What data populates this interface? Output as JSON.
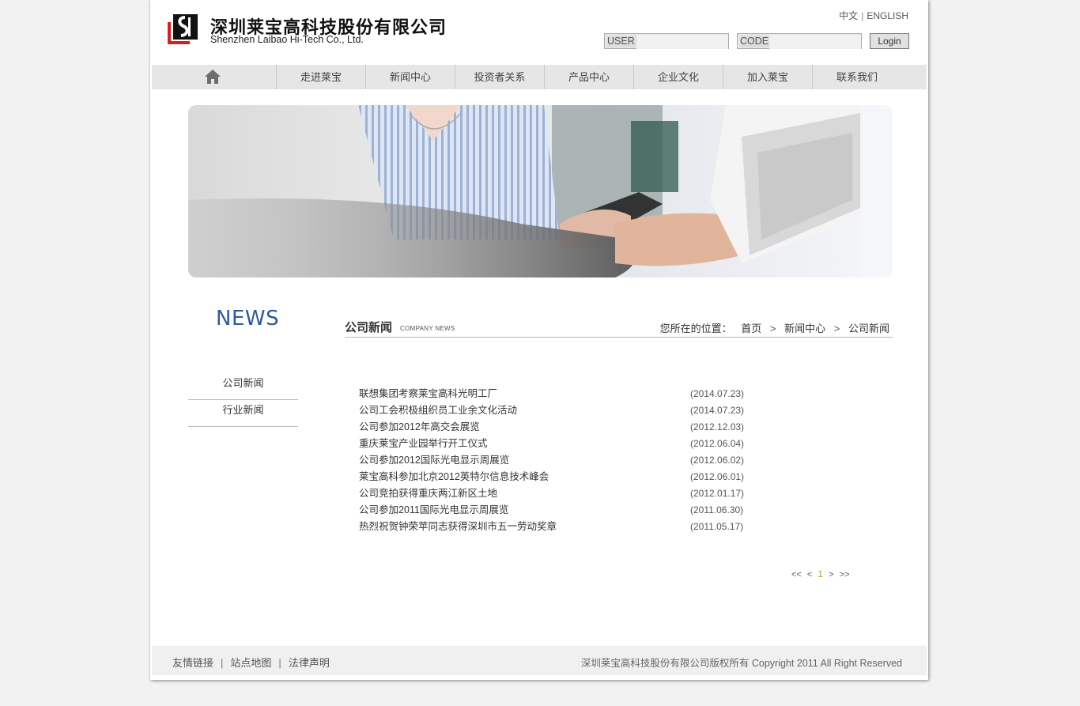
{
  "header": {
    "logo_cn": "深圳莱宝高科技股份有限公司",
    "logo_en": "Shenzhen Laibao Hi-Tech Co., Ltd.",
    "lang_cn": "中文",
    "lang_sep": "|",
    "lang_en": "ENGLISH",
    "user_label": "USER",
    "code_label": "CODE",
    "login_label": "Login"
  },
  "nav": {
    "home_icon": "home-icon",
    "items": [
      "走进莱宝",
      "新闻中心",
      "投资者关系",
      "产品中心",
      "企业文化",
      "加入莱宝",
      "联系我们"
    ]
  },
  "sidebar": {
    "title": "NEWS",
    "items": [
      "公司新闻",
      "行业新闻"
    ]
  },
  "section": {
    "title_cn": "公司新闻",
    "title_en": "COMPANY NEWS",
    "breadcrumb_label": "您所在的位置：",
    "breadcrumb": [
      "首页",
      "新闻中心",
      "公司新闻"
    ]
  },
  "news": [
    {
      "title": "联想集团考察莱宝高科光明工厂",
      "date": "(2014.07.23)"
    },
    {
      "title": "公司工会积极组织员工业余文化活动",
      "date": "(2014.07.23)"
    },
    {
      "title": "公司参加2012年高交会展览",
      "date": "(2012.12.03)"
    },
    {
      "title": "重庆莱宝产业园举行开工仪式",
      "date": "(2012.06.04)"
    },
    {
      "title": "公司参加2012国际光电显示周展览",
      "date": "(2012.06.02)"
    },
    {
      "title": "莱宝高科参加北京2012英特尔信息技术峰会",
      "date": "(2012.06.01)"
    },
    {
      "title": "公司竞拍获得重庆两江新区土地",
      "date": "(2012.01.17)"
    },
    {
      "title": "公司参加2011国际光电显示周展览",
      "date": "(2011.06.30)"
    },
    {
      "title": "热烈祝贺钟荣苹同志获得深圳市五一劳动奖章",
      "date": "(2011.05.17)"
    }
  ],
  "pager": {
    "first": "<<",
    "prev": "<",
    "current": "1",
    "next": ">",
    "last": ">>"
  },
  "footer": {
    "links": [
      "友情链接",
      "站点地图",
      "法律声明"
    ],
    "sep": "|",
    "copyright": "深圳莱宝高科技股份有限公司版权所有 Copyright 2011 All Right Reserved"
  },
  "colors": {
    "news_title": "#2c5aa0",
    "pager_current": "#c49b23",
    "logo_red": "#d42020"
  }
}
